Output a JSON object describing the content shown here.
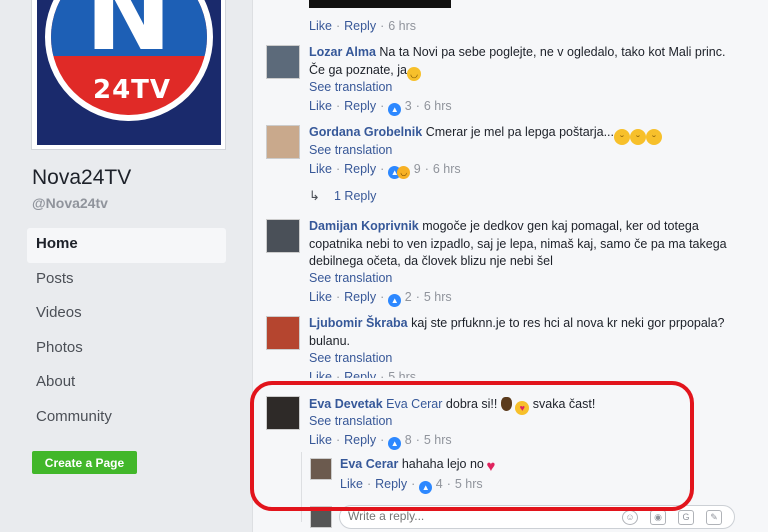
{
  "page": {
    "name": "Nova24TV",
    "handle": "@Nova24tv",
    "logo_text": "24TV",
    "logo_letter": "N"
  },
  "nav": [
    {
      "label": "Home",
      "active": true
    },
    {
      "label": "Posts"
    },
    {
      "label": "Videos"
    },
    {
      "label": "Photos"
    },
    {
      "label": "About"
    },
    {
      "label": "Community"
    }
  ],
  "create_page_label": "Create a Page",
  "actions": {
    "like": "Like",
    "reply": "Reply",
    "see_translation": "See translation"
  },
  "top_meta": {
    "time": "6 hrs"
  },
  "comments": [
    {
      "author": "Lozar Alma",
      "text": "Na ta Novi pa sebe poglejte, ne v ogledalo, tako kot Mali princ. Če ga poznate, ja",
      "reactions": "3",
      "time": "6 hrs"
    },
    {
      "author": "Gordana Grobelnik",
      "text": "Cmerar je mel pa lepga poštarja...",
      "reactions": "9",
      "time": "6 hrs",
      "replies_label": "1 Reply"
    },
    {
      "author": "Damijan Koprivnik",
      "text": "mogoče je dedkov gen kaj pomagal, ker od totega copatnika nebi to ven izpadlo, saj je lepa, nimaš kaj, samo če pa ma takega debilnega očeta, da človek blizu nje nebi šel",
      "reactions": "2",
      "time": "5 hrs"
    },
    {
      "author": "Ljubomir Škraba",
      "text": "kaj ste prfuknn.je to res hci al nova kr neki gor prpopala? bulanu.",
      "time": "5 hrs"
    },
    {
      "author": "Eva Devetak",
      "tag": "Eva Cerar",
      "text": "dobra si!!",
      "text_after": "svaka čast!",
      "reactions": "8",
      "time": "5 hrs"
    }
  ],
  "nested_reply": {
    "author": "Eva Cerar",
    "text": "hahaha lejo no",
    "reactions": "4",
    "time": "5 hrs"
  },
  "reply_box": {
    "placeholder": "Write a reply..."
  },
  "colors": {
    "highlight": "#e2141c",
    "link": "#365899",
    "create_button": "#42b72a"
  }
}
